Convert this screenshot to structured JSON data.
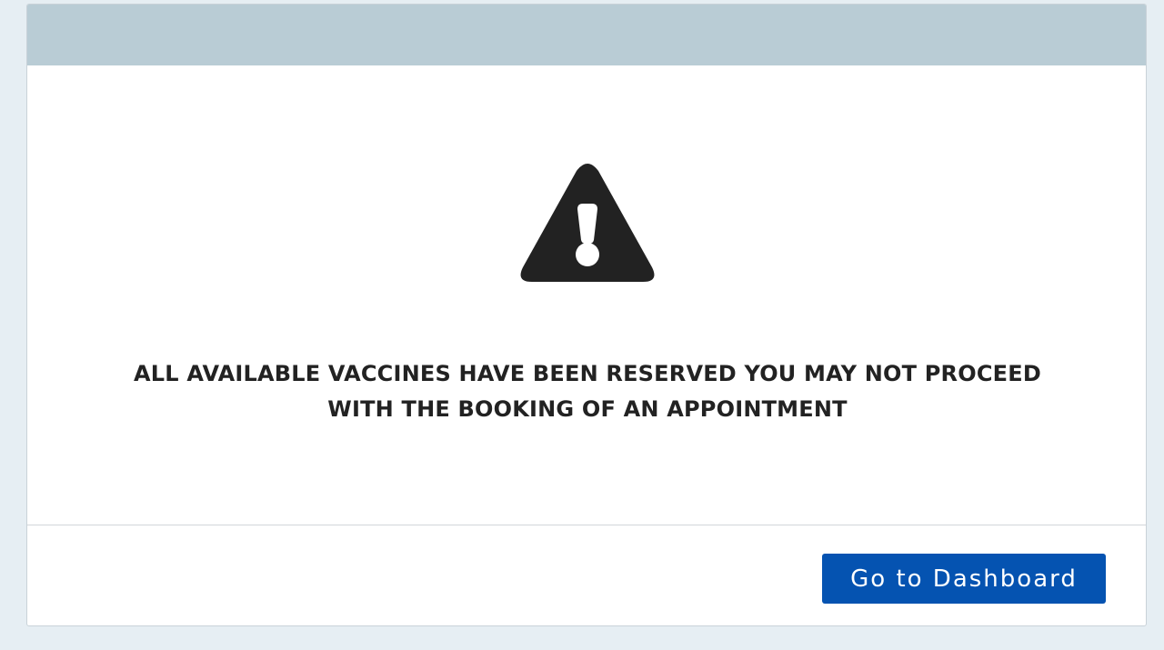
{
  "modal": {
    "header_color": "#b9ccd5",
    "icon": "warning-triangle-icon",
    "message_line1": "ALL AVAILABLE VACCINES HAVE BEEN RESERVED YOU MAY NOT PROCEED",
    "message_line2": "WITH THE BOOKING OF AN APPOINTMENT",
    "button_label": "Go to Dashboard",
    "button_color": "#0553b1"
  }
}
